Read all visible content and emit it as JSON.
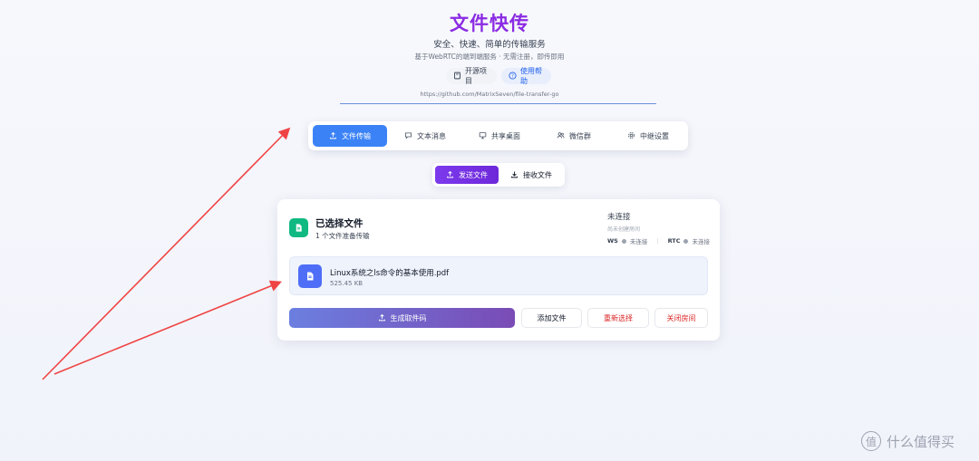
{
  "header": {
    "title": "文件快传",
    "subtitle": "安全、快速、简单的传输服务",
    "tagline": "基于WebRTC的端到端服务 · 无需注册，即传即用",
    "open_source_label": "开源项目",
    "help_label": "使用帮助",
    "repo_url": "https://github.com/MatrixSeven/file-transfer-go"
  },
  "tabs": [
    {
      "label": "文件传输",
      "icon": "upload-icon",
      "active": true
    },
    {
      "label": "文本消息",
      "icon": "message-icon",
      "active": false
    },
    {
      "label": "共享桌面",
      "icon": "monitor-icon",
      "active": false
    },
    {
      "label": "微信群",
      "icon": "users-icon",
      "active": false
    },
    {
      "label": "中继设置",
      "icon": "gear-icon",
      "active": false
    }
  ],
  "modes": {
    "send_label": "发送文件",
    "receive_label": "接收文件"
  },
  "selection": {
    "title": "已选择文件",
    "subtitle": "1 个文件准备传输"
  },
  "connection": {
    "status": "未连接",
    "room_status": "尚未创建房间",
    "ws_label": "WS",
    "ws_status": "未连接",
    "rtc_label": "RTC",
    "rtc_status": "未连接"
  },
  "file": {
    "name": "Linux系统之ls命令的基本使用.pdf",
    "size": "525.45 KB"
  },
  "actions": {
    "generate_label": "生成取件码",
    "add_label": "添加文件",
    "reselect_label": "重新选择",
    "close_label": "关闭房间"
  },
  "watermark": {
    "logo_char": "值",
    "text": "什么值得买"
  },
  "colors": {
    "title": "#8b2be2",
    "active_tab": "#3b82f6",
    "send_active": "#7c3aed",
    "danger": "#dc2626",
    "arrow": "#ef4444"
  }
}
